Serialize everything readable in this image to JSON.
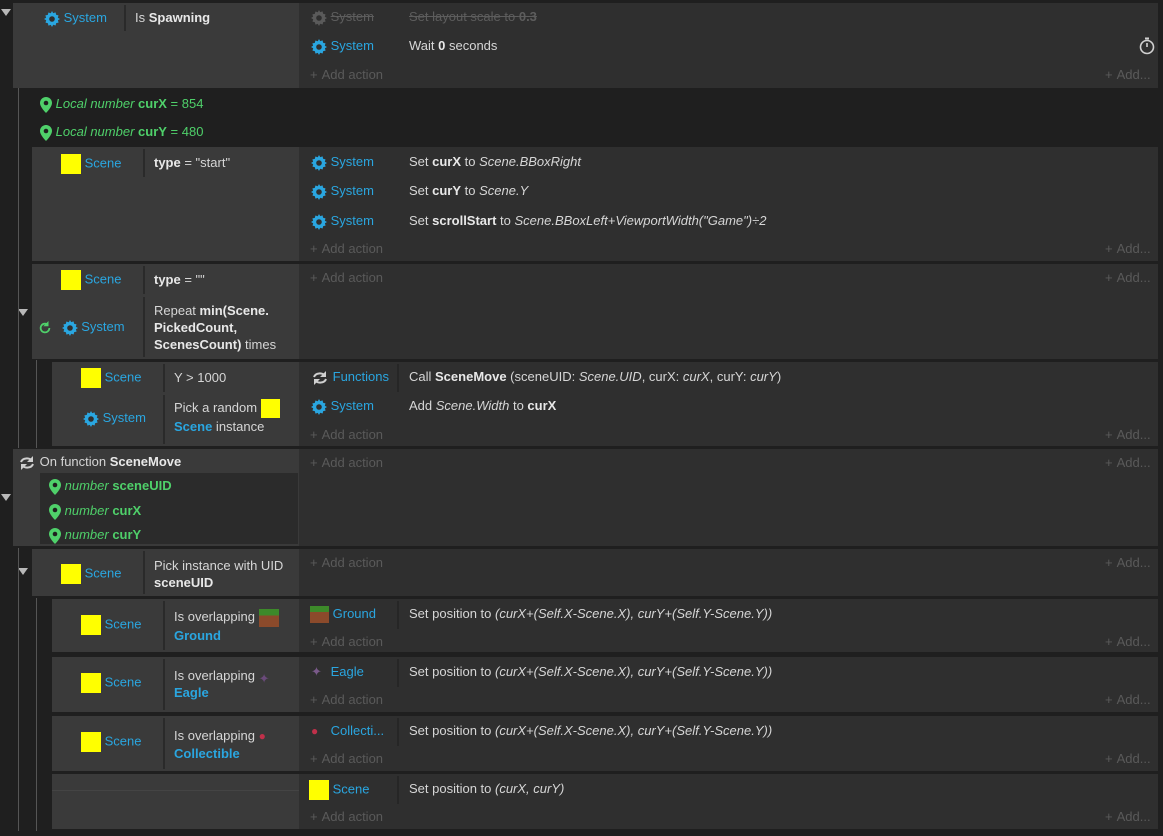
{
  "events": {
    "e1": {
      "cond_obj": "System",
      "cond_text_pre": "Is ",
      "cond_text_bold": "Spawning",
      "a1_obj": "System",
      "a1_text_pre": "Set layout scale to ",
      "a1_text_bold": "0.3",
      "a2_obj": "System",
      "a2_text_pre": "Wait ",
      "a2_text_bold": "0",
      "a2_text_post": " seconds"
    },
    "locals": {
      "l1_pre": "Local number",
      "l1_name": "curX",
      "l1_val": " = 854",
      "l2_pre": "Local number",
      "l2_name": "curY",
      "l2_val": " = 480"
    },
    "e2": {
      "cond_obj": "Scene",
      "cond_bold": "type",
      "cond_rest": " = \"start\"",
      "a1_obj": "System",
      "a1_set": "Set ",
      "a1_var": "curX",
      "a1_to": " to ",
      "a1_expr": "Scene.BBoxRight",
      "a2_obj": "System",
      "a2_set": "Set ",
      "a2_var": "curY",
      "a2_to": " to ",
      "a2_expr": "Scene.Y",
      "a3_obj": "System",
      "a3_set": "Set ",
      "a3_var": "scrollStart",
      "a3_to": " to ",
      "a3_expr": "Scene.BBoxLeft+ViewportWidth(\"Game\")÷2"
    },
    "e3": {
      "c1_obj": "Scene",
      "c1_bold": "type",
      "c1_rest": " = \"\"",
      "c2_obj": "System",
      "c2_l1_pre": "Repeat ",
      "c2_l1_bold": "min(Scene.",
      "c2_l2_bold": "PickedCount,",
      "c2_l3_bold": "ScenesCount)",
      "c2_l3_post": " times"
    },
    "e4": {
      "c1_obj": "Scene",
      "c1_text": "Y > 1000",
      "c2_obj": "System",
      "c2_l1": "Pick a random",
      "c2_l2_obj": "Scene",
      "c2_l2_post": " instance",
      "a1_obj": "Functions",
      "a1_call": "Call ",
      "a1_fn": "SceneMove",
      "a1_args_1": " (sceneUID: ",
      "a1_args_2": "Scene.UID",
      "a1_args_3": ", curX: ",
      "a1_args_4": "curX",
      "a1_args_5": ", curY: ",
      "a1_args_6": "curY",
      "a1_args_7": ")",
      "a2_obj": "System",
      "a2_add": "Add ",
      "a2_expr": "Scene.Width",
      "a2_to": " to ",
      "a2_var": "curX"
    },
    "fn": {
      "title_pre": "On function ",
      "title_bold": "SceneMove",
      "p1_type": "number",
      "p1_name": "sceneUID",
      "p2_type": "number",
      "p2_name": "curX",
      "p3_type": "number",
      "p3_name": "curY"
    },
    "e5": {
      "cond_obj": "Scene",
      "cond_l1": "Pick instance with UID",
      "cond_l2": "sceneUID"
    },
    "e6": {
      "cond_obj": "Scene",
      "cond_l1": "Is overlapping",
      "cond_l2": "Ground",
      "a_obj": "Ground",
      "a_text_pre": "Set position to ",
      "a_text_expr": "(curX+(Self.X-Scene.X), curY+(Self.Y-Scene.Y))"
    },
    "e7": {
      "cond_obj": "Scene",
      "cond_l1": "Is overlapping",
      "cond_l2": "Eagle",
      "a_obj": "Eagle",
      "a_text_pre": "Set position to ",
      "a_text_expr": "(curX+(Self.X-Scene.X), curY+(Self.Y-Scene.Y))"
    },
    "e8": {
      "cond_obj": "Scene",
      "cond_l1": "Is overlapping",
      "cond_l2": "Collectible",
      "a_obj": "Collecti...",
      "a_text_pre": "Set position to ",
      "a_text_expr": "(curX+(Self.X-Scene.X), curY+(Self.Y-Scene.Y))"
    },
    "e9": {
      "a_obj": "Scene",
      "a_text_pre": "Set position to ",
      "a_text_expr": "(curX, curY)"
    }
  },
  "labels": {
    "add_action": "Add action",
    "add_more": "Add..."
  },
  "colors": {
    "object_link": "#2aa6e0",
    "local_var": "#4fd06a",
    "scene_swatch": "#ffff00",
    "background": "#1f1f1f",
    "event_bg": "#2f2f2f",
    "condition_bg": "#3a3a3a"
  },
  "icons": {
    "system": "gear-icon",
    "local": "map-pin-icon",
    "function": "function-arrows-icon",
    "repeat": "loop-icon",
    "wait": "stopwatch-icon",
    "collapse": "triangle-down-icon"
  }
}
